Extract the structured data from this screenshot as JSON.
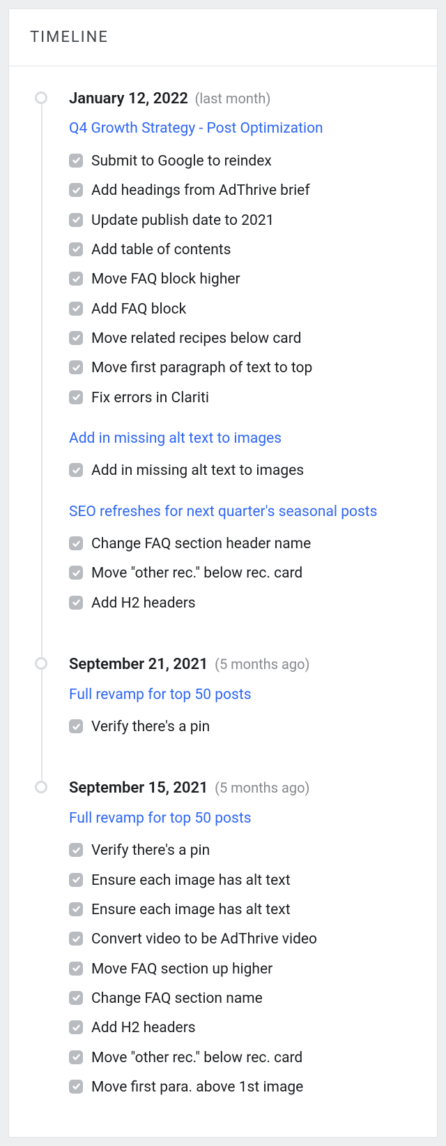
{
  "header": {
    "title": "TIMELINE"
  },
  "entries": [
    {
      "date": "January 12, 2022",
      "relative": "(last month)",
      "groups": [
        {
          "link": "Q4 Growth Strategy - Post Optimization",
          "tasks": [
            "Submit to Google to reindex",
            "Add headings from AdThrive brief",
            "Update publish date to 2021",
            "Add table of contents",
            "Move FAQ block higher",
            "Add FAQ block",
            "Move related recipes below card",
            "Move first paragraph of text to top",
            "Fix errors in Clariti"
          ]
        },
        {
          "link": "Add in missing alt text to images",
          "tasks": [
            "Add in missing alt text to images"
          ]
        },
        {
          "link": "SEO refreshes for next quarter's seasonal posts",
          "tasks": [
            "Change FAQ section header name",
            "Move \"other rec.\" below rec. card",
            "Add H2 headers"
          ]
        }
      ]
    },
    {
      "date": "September 21, 2021",
      "relative": "(5 months ago)",
      "groups": [
        {
          "link": "Full revamp for top 50 posts",
          "tasks": [
            "Verify there's a pin"
          ]
        }
      ]
    },
    {
      "date": "September 15, 2021",
      "relative": "(5 months ago)",
      "groups": [
        {
          "link": "Full revamp for top 50 posts",
          "tasks": [
            "Verify there's a pin",
            "Ensure each image has alt text",
            "Ensure each image has alt text",
            "Convert video to be AdThrive video",
            "Move FAQ section up higher",
            "Change FAQ section name",
            "Add H2 headers",
            "Move \"other rec.\" below rec. card",
            "Move first para. above 1st image"
          ]
        }
      ]
    }
  ]
}
